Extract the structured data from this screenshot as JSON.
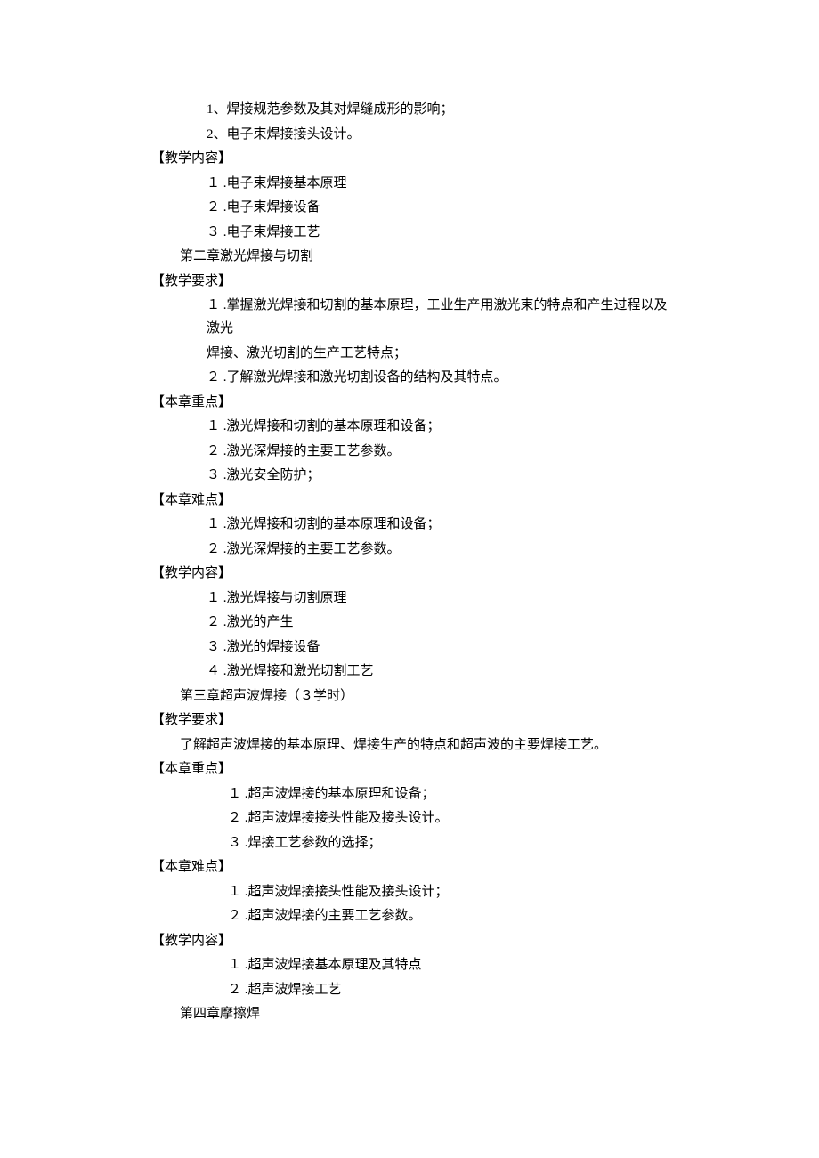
{
  "lines": [
    {
      "text": "1、焊接规范参数及其对焊缝成形的影响；",
      "indent": 3
    },
    {
      "text": "2、电子束焊接接头设计。",
      "indent": 3
    },
    {
      "text": "【教学内容】",
      "indent": 0
    },
    {
      "text": "１ .电子束焊接基本原理",
      "indent": 3
    },
    {
      "text": "２ .电子束焊接设备",
      "indent": 3
    },
    {
      "text": "３ .电子束焊接工艺",
      "indent": 3
    },
    {
      "text": "第二章激光焊接与切割",
      "indent": 2
    },
    {
      "text": "【教学要求】",
      "indent": 0
    },
    {
      "text": "１ .掌握激光焊接和切割的基本原理，工业生产用激光束的特点和产生过程以及激光",
      "indent": 3
    },
    {
      "text": "焊接、激光切割的生产工艺特点；",
      "indent": 3,
      "noNumPad": true
    },
    {
      "text": "２ .了解激光焊接和激光切割设备的结构及其特点。",
      "indent": 3
    },
    {
      "text": "【本章重点】",
      "indent": 0
    },
    {
      "text": "１ .激光焊接和切割的基本原理和设备；",
      "indent": 3
    },
    {
      "text": "２ .激光深焊接的主要工艺参数。",
      "indent": 3
    },
    {
      "text": "３ .激光安全防护；",
      "indent": 3
    },
    {
      "text": "【本章难点】",
      "indent": 0
    },
    {
      "text": "１ .激光焊接和切割的基本原理和设备；",
      "indent": 3
    },
    {
      "text": "２ .激光深焊接的主要工艺参数。",
      "indent": 3
    },
    {
      "text": "【教学内容】",
      "indent": 0
    },
    {
      "text": "１ .激光焊接与切割原理",
      "indent": 3
    },
    {
      "text": "２ .激光的产生",
      "indent": 3
    },
    {
      "text": "３ .激光的焊接设备",
      "indent": 3
    },
    {
      "text": "４ .激光焊接和激光切割工艺",
      "indent": 3
    },
    {
      "text": "第三章超声波焊接（３学时）",
      "indent": 2
    },
    {
      "text": "【教学要求】",
      "indent": 0
    },
    {
      "text": "了解超声波焊接的基本原理、焊接生产的特点和超声波的主要焊接工艺。",
      "indent": 2
    },
    {
      "text": "【本章重点】",
      "indent": 0
    },
    {
      "text": "１ .超声波焊接的基本原理和设备；",
      "indent": 4
    },
    {
      "text": "２ .超声波焊接接头性能及接头设计。",
      "indent": 4
    },
    {
      "text": "３ .焊接工艺参数的选择；",
      "indent": 4
    },
    {
      "text": "【本章难点】",
      "indent": 0
    },
    {
      "text": "１ .超声波焊接接头性能及接头设计；",
      "indent": 4
    },
    {
      "text": "２ .超声波焊接的主要工艺参数。",
      "indent": 4
    },
    {
      "text": "【教学内容】",
      "indent": 0
    },
    {
      "text": "１ .超声波焊接基本原理及其特点",
      "indent": 4
    },
    {
      "text": "２ .超声波焊接工艺",
      "indent": 4
    },
    {
      "text": "第四章摩擦焊",
      "indent": 2
    }
  ]
}
